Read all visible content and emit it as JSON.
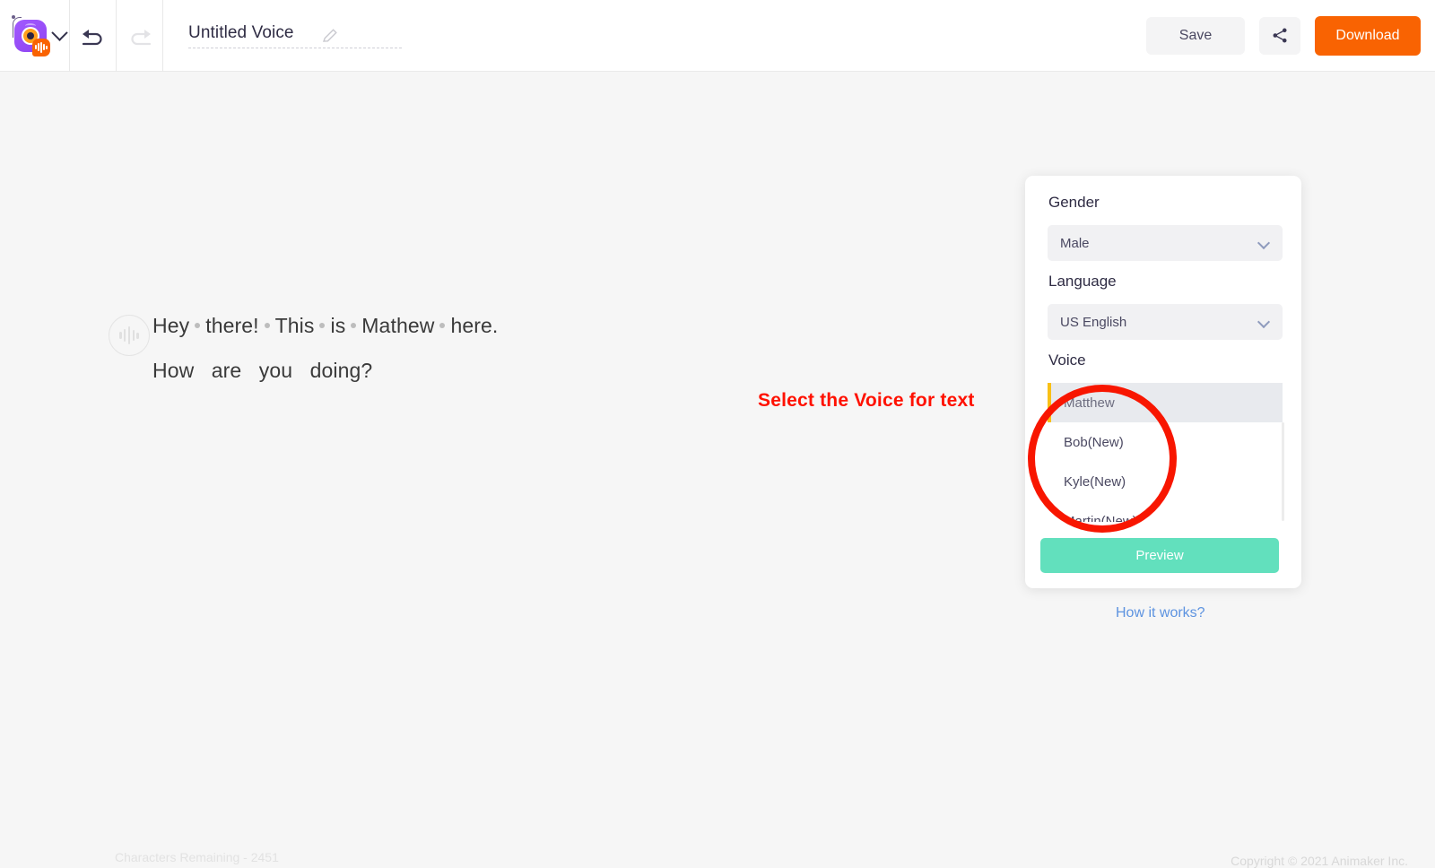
{
  "topbar": {
    "logo_name": "animaker-voice-logo",
    "logo_dropdown_icon": "chevron-down-icon",
    "undo_icon": "undo-arrow-icon",
    "redo_icon": "redo-arrow-icon",
    "project_title": "Untitled Voice",
    "edit_title_icon": "pencil-icon",
    "save_label": "Save",
    "share_icon": "share-icon",
    "download_label": "Download"
  },
  "script": {
    "speech_icon": "audio-waveform-icon",
    "line1_words": [
      "Hey",
      "there!",
      "This",
      "is",
      "Mathew",
      "here."
    ],
    "line2": "How   are   you   doing?"
  },
  "panel": {
    "gender_label": "Gender",
    "gender_value": "Male",
    "language_label": "Language",
    "language_value": "US English",
    "voice_label": "Voice",
    "voice_options": [
      {
        "label": "Matthew",
        "selected": true
      },
      {
        "label": "Bob(New)",
        "selected": false
      },
      {
        "label": "Kyle(New)",
        "selected": false
      },
      {
        "label": "Martin(New)",
        "selected": false
      }
    ],
    "preview_label": "Preview",
    "how_it_works_label": "How it works?",
    "accent_selected_bar": "#f9c016",
    "preview_color": "#62e0bd"
  },
  "annotation": {
    "text": "Select the Voice for text",
    "color": "#ff1100",
    "circle_target": "voice-dropdown-options"
  },
  "footer": {
    "characters_remaining": "Characters Remaining - 2451",
    "copyright": "Copyright © 2021 Animaker Inc."
  }
}
